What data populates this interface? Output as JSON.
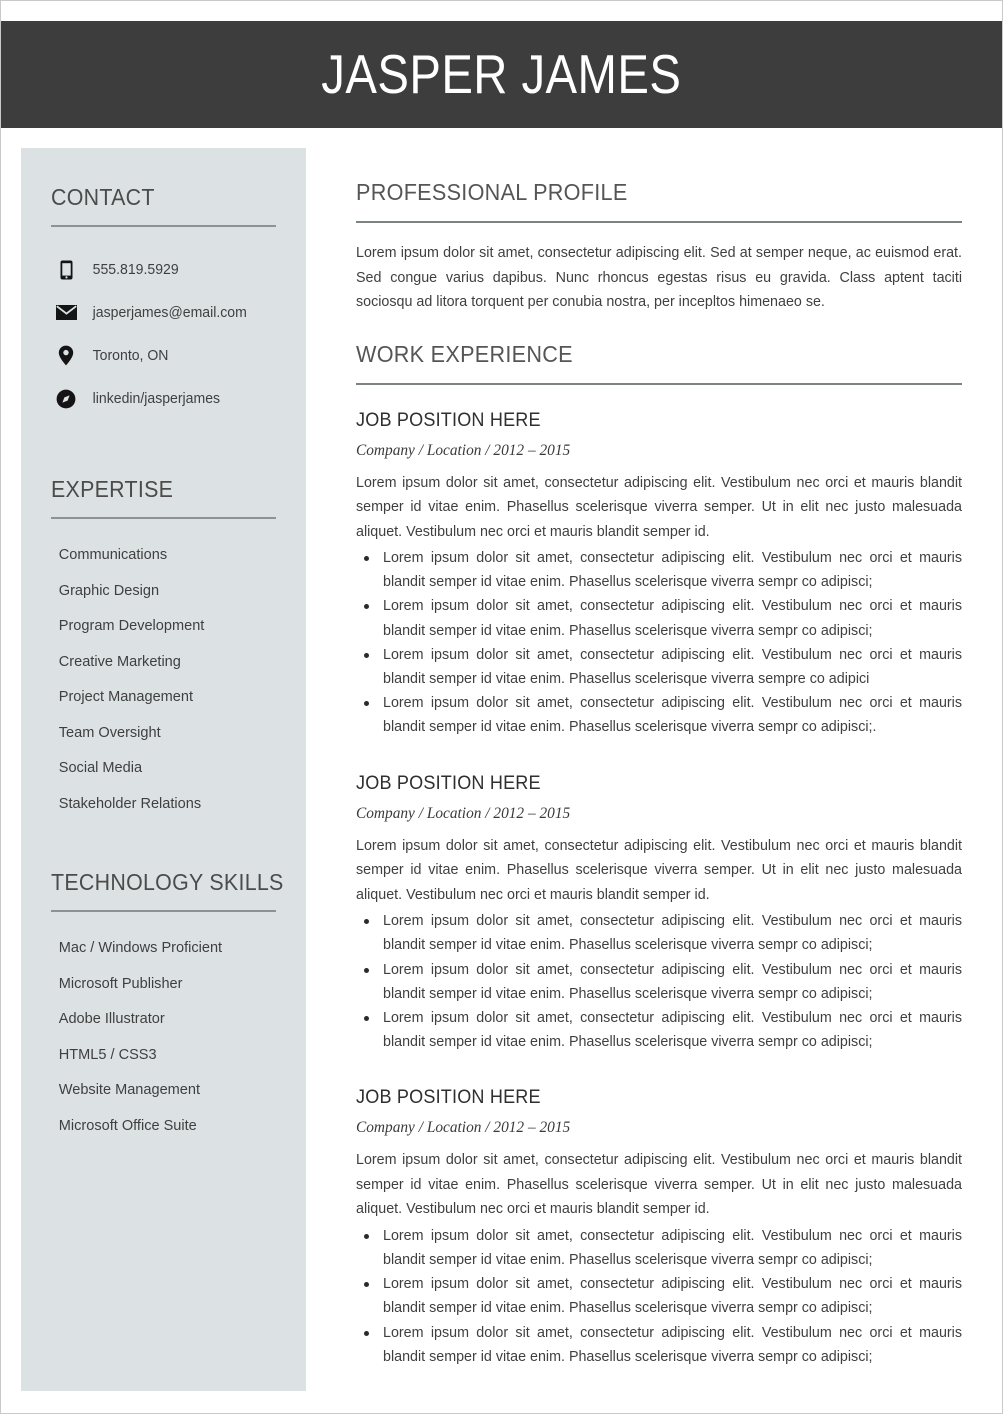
{
  "header": {
    "name": "JASPER JAMES"
  },
  "sidebar": {
    "contact": {
      "heading": "CONTACT",
      "items": [
        {
          "icon": "phone-icon",
          "value": "555.819.5929"
        },
        {
          "icon": "email-icon",
          "value": "jasperjames@email.com"
        },
        {
          "icon": "location-pin-icon",
          "value": "Toronto, ON"
        },
        {
          "icon": "compass-icon",
          "value": "linkedin/jasperjames"
        }
      ]
    },
    "expertise": {
      "heading": "EXPERTISE",
      "items": [
        "Communications",
        "Graphic Design",
        "Program Development",
        "Creative Marketing",
        "Project Management",
        "Team Oversight",
        "Social Media",
        "Stakeholder Relations"
      ]
    },
    "technology": {
      "heading": "TECHNOLOGY SKILLS",
      "items": [
        "Mac / Windows Proficient",
        "Microsoft Publisher",
        "Adobe Illustrator",
        "HTML5 / CSS3",
        "Website Management",
        "Microsoft Office Suite"
      ]
    }
  },
  "main": {
    "profile": {
      "heading": "PROFESSIONAL PROFILE",
      "text": "Lorem ipsum dolor sit amet, consectetur adipiscing elit. Sed at semper neque, ac euismod erat. Sed congue varius dapibus. Nunc rhoncus egestas risus eu gravida. Class aptent taciti sociosqu ad litora torquent per conubia nostra, per incepltos himenaeo se."
    },
    "experience": {
      "heading": "WORK EXPERIENCE",
      "jobs": [
        {
          "title": "JOB POSITION HERE",
          "meta": "Company / Location /  2012 – 2015",
          "description": "Lorem ipsum dolor sit amet, consectetur adipiscing elit. Vestibulum nec orci et mauris blandit semper id vitae enim. Phasellus scelerisque viverra semper. Ut in elit nec justo malesuada aliquet. Vestibulum nec orci et mauris blandit semper id.",
          "bullets": [
            "Lorem ipsum dolor sit amet, consectetur adipiscing elit. Vestibulum nec orci et mauris blandit semper id vitae enim. Phasellus scelerisque viverra sempr co adipisci;",
            "Lorem ipsum dolor sit amet, consectetur adipiscing elit. Vestibulum nec orci et mauris blandit semper id vitae enim. Phasellus scelerisque viverra sempr co adipisci;",
            "Lorem ipsum dolor sit amet, consectetur adipiscing elit. Vestibulum nec orci et mauris blandit semper id vitae enim. Phasellus scelerisque viverra sempre co adipici",
            "Lorem ipsum dolor sit amet, consectetur adipiscing elit. Vestibulum nec orci et mauris blandit semper id vitae enim. Phasellus scelerisque viverra sempr co adipisci;."
          ]
        },
        {
          "title": "JOB POSITION HERE",
          "meta": "Company / Location /  2012 – 2015",
          "description": "Lorem ipsum dolor sit amet, consectetur adipiscing elit. Vestibulum nec orci et mauris blandit semper id vitae enim. Phasellus scelerisque viverra semper. Ut in elit nec justo malesuada aliquet. Vestibulum nec orci et mauris blandit semper id.",
          "bullets": [
            "Lorem ipsum dolor sit amet, consectetur adipiscing elit. Vestibulum nec orci et mauris blandit semper id vitae enim. Phasellus scelerisque viverra sempr co adipisci;",
            "Lorem ipsum dolor sit amet, consectetur adipiscing elit. Vestibulum nec orci et mauris blandit semper id vitae enim. Phasellus scelerisque viverra sempr co adipisci;",
            "Lorem ipsum dolor sit amet, consectetur adipiscing elit. Vestibulum nec orci et mauris blandit semper id vitae enim. Phasellus scelerisque viverra sempr co adipisci;"
          ]
        },
        {
          "title": "JOB POSITION HERE",
          "meta": "Company / Location /  2012 – 2015",
          "description": "Lorem ipsum dolor sit amet, consectetur adipiscing elit. Vestibulum nec orci et mauris blandit semper id vitae enim. Phasellus scelerisque viverra semper. Ut in elit nec justo malesuada aliquet. Vestibulum nec orci et mauris blandit semper id.",
          "bullets": [
            "Lorem ipsum dolor sit amet, consectetur adipiscing elit. Vestibulum nec orci et mauris blandit semper id vitae enim. Phasellus scelerisque viverra sempr co adipisci;",
            "Lorem ipsum dolor sit amet, consectetur adipiscing elit. Vestibulum nec orci et mauris blandit semper id vitae enim. Phasellus scelerisque viverra sempr co adipisci;",
            "Lorem ipsum dolor sit amet, consectetur adipiscing elit. Vestibulum nec orci et mauris blandit semper id vitae enim. Phasellus scelerisque viverra sempr co adipisci;"
          ]
        }
      ]
    }
  },
  "colors": {
    "header_band": "#3d3d3d",
    "sidebar_background": "#dce2e4",
    "rule": "#8d9395",
    "text": "#3f3f3f"
  }
}
